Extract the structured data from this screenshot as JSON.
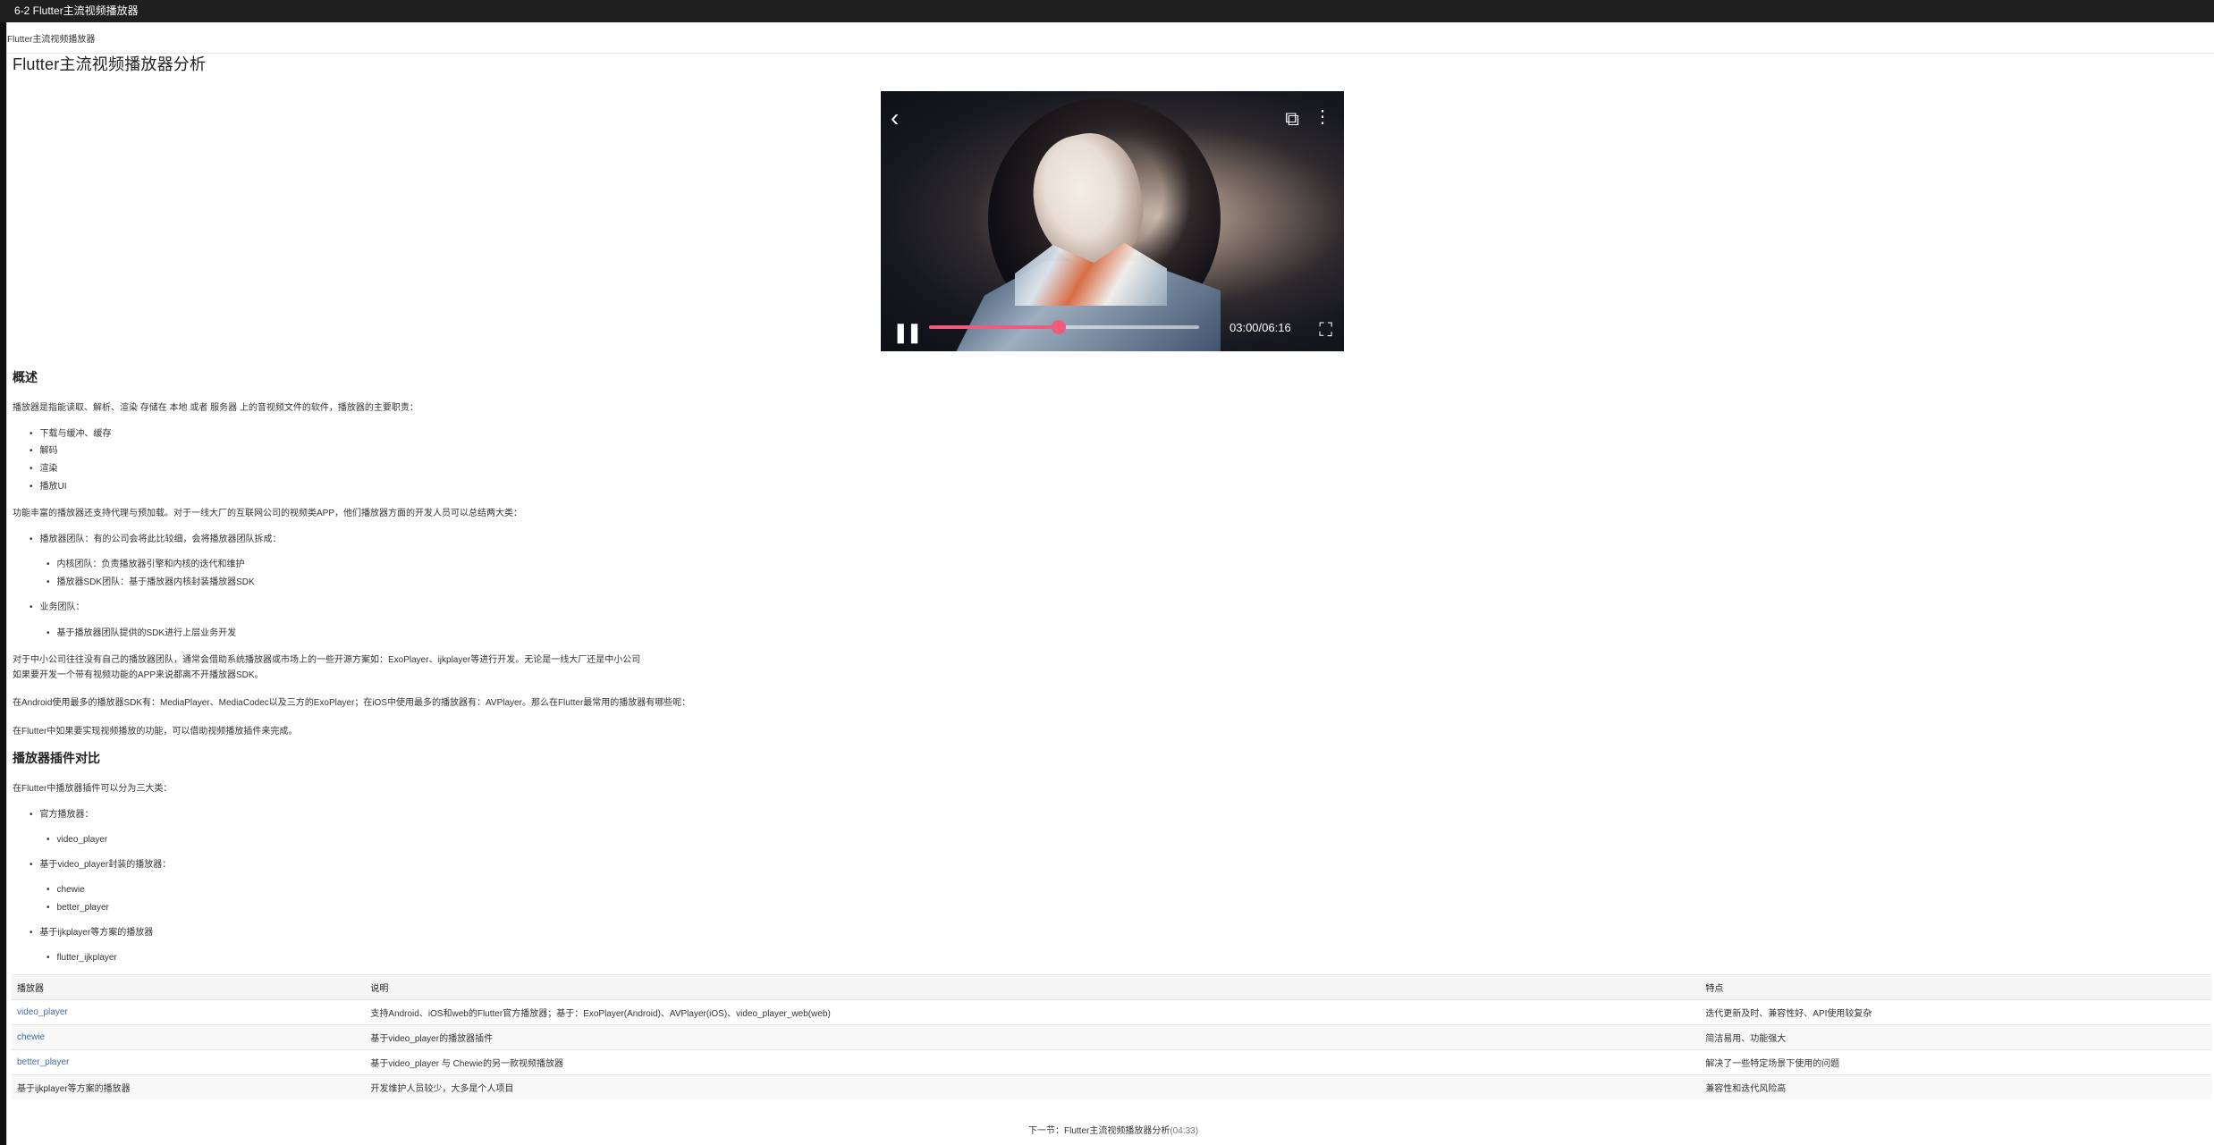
{
  "window": {
    "title": "6-2 Flutter主流视频播放器"
  },
  "page": {
    "breadcrumb": "Flutter主流视频播放器",
    "heading": "Flutter主流视频播放器分析"
  },
  "video_player": {
    "icons": {
      "back": "‹",
      "tv": "⧉",
      "more": "⋮",
      "pause": "❚❚",
      "fullscreen": "⛶"
    },
    "progress": 0.48,
    "time": "03:00/06:16"
  },
  "content": {
    "overview_title": "概述",
    "overview_intro": "播放器是指能读取、解析、渲染 存储在 本地 或者 服务器 上的音视频文件的软件，播放器的主要职责：",
    "overview_items": [
      "下载与缓冲、缓存",
      "解码",
      "渲染",
      "播放UI"
    ],
    "capabilities": "功能丰富的播放器还支持代理与预加载。对于一线大厂的互联网公司的视频类APP，他们播放器方面的开发人员可以总结两大类：",
    "teams": [
      {
        "label": "播放器团队：有的公司会将此比较细，会将播放器团队拆成：",
        "children": [
          "内核团队：负责播放器引擎和内核的迭代和维护",
          "播放器SDK团队：基于播放器内核封装播放器SDK"
        ]
      },
      {
        "label": "业务团队：",
        "children": [
          "基于播放器团队提供的SDK进行上层业务开发"
        ]
      }
    ],
    "small_company_1": "对于中小公司往往没有自己的播放器团队，通常会借助系统播放器或市场上的一些开源方案如：ExoPlayer、ijkplayer等进行开发。无论是一线大厂还是中小公司",
    "small_company_2": "如果要开发一个带有视频功能的APP来说都离不开播放器SDK。",
    "platforms": "在Android使用最多的播放器SDK有：MediaPlayer、MediaCodec以及三方的ExoPlayer；在iOS中使用最多的播放器有：AVPlayer。那么在Flutter最常用的播放器有哪些呢：",
    "flutter_intro": "在Flutter中如果要实现视频播放的功能，可以借助视频播放插件来完成。",
    "comparison_title": "播放器插件对比",
    "classification": "在Flutter中播放器插件可以分为三大类：",
    "categories": [
      {
        "label": "官方播放器：",
        "children": [
          "video_player"
        ]
      },
      {
        "label": "基于video_player封装的播放器：",
        "children": [
          "chewie",
          "better_player"
        ]
      },
      {
        "label": "基于ijkplayer等方案的播放器",
        "children": [
          "flutter_ijkplayer"
        ]
      }
    ]
  },
  "table": {
    "headers": [
      "播放器",
      "说明",
      "特点"
    ],
    "rows": [
      [
        "video_player",
        "支持Android、iOS和web的Flutter官方播放器；基于：ExoPlayer(Android)、AVPlayer(iOS)、video_player_web(web)",
        "迭代更新及时、兼容性好、API使用较复杂"
      ],
      [
        "chewie",
        "基于video_player的播放器插件",
        "简洁易用、功能强大"
      ],
      [
        "better_player",
        "基于video_player 与 Chewie的另一款视频播放器",
        "解决了一些特定场景下使用的问题"
      ],
      [
        "基于ijkplayer等方案的播放器",
        "开发维护人员较少，大多是个人项目",
        "兼容性和迭代风险高"
      ]
    ]
  },
  "footer": {
    "prefix": "下一节：",
    "title": "Flutter主流视频播放器分析",
    "time": "(04:33)"
  }
}
